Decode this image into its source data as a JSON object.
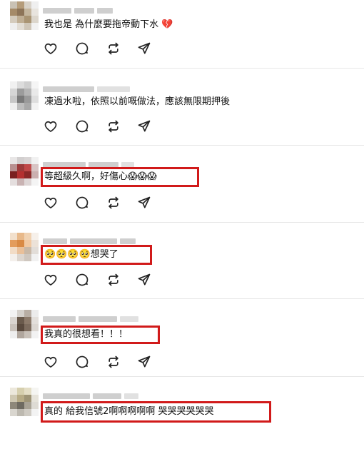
{
  "comments": [
    {
      "text": "我也是 為什麼要拖帝動下水 💔",
      "highlighted": false
    },
    {
      "text": "凍過水啦，依照以前嘅做法，應該無限期押後",
      "highlighted": false
    },
    {
      "text": "等超級久啊，好傷心😱😱😱",
      "highlighted": true
    },
    {
      "text": "🥺🥺🥺🥺想哭了",
      "highlighted": true
    },
    {
      "text": "我真的很想看！！！",
      "highlighted": true
    },
    {
      "text": "真的 給我信號2啊啊啊啊啊 哭哭哭哭哭哭",
      "highlighted": true
    }
  ],
  "actions": [
    {
      "icon": "heart-icon"
    },
    {
      "icon": "comment-icon"
    },
    {
      "icon": "repost-icon"
    },
    {
      "icon": "share-icon"
    }
  ],
  "colors": {
    "highlight": "#d11a1a",
    "separator": "#e6e6e6",
    "icon": "#222222"
  }
}
